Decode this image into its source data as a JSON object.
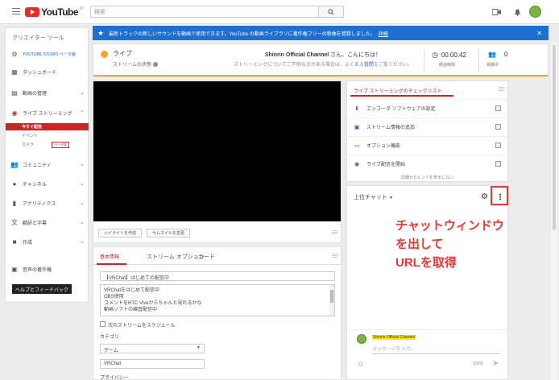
{
  "header": {
    "logo_text": "YouTube",
    "logo_sup": "JP",
    "search_placeholder": "検索"
  },
  "sidebar": {
    "title": "クリエイター ツール",
    "items": [
      {
        "label": "YOUTUBE STUDIO ベータ版",
        "icon": "gear-icon"
      },
      {
        "label": "ダッシュボード",
        "icon": "dashboard-icon"
      },
      {
        "label": "動画の管理",
        "icon": "video-manager-icon"
      },
      {
        "label": "ライブ ストリーミング",
        "icon": "live-streaming-icon"
      },
      {
        "label": "コミュニティ",
        "icon": "community-icon"
      },
      {
        "label": "チャンネル",
        "icon": "channel-icon"
      },
      {
        "label": "アナリティクス",
        "icon": "analytics-icon"
      },
      {
        "label": "翻訳と字幕",
        "icon": "translate-icon"
      },
      {
        "label": "作成",
        "icon": "create-icon"
      },
      {
        "label": "音声の著作権",
        "icon": "audio-icon"
      }
    ],
    "sub_items": [
      {
        "label": "今すぐ配信"
      },
      {
        "label": "イベント"
      },
      {
        "label": "カメラ",
        "badge": "ベータ版"
      }
    ],
    "help_button": "ヘルプとフィードバック"
  },
  "banner": {
    "text": "最新トラックの新しいサウンドを動画で使用できます。YouTube の動画ライブラリに著作権フリーの新曲を登録しました。",
    "link": "詳細",
    "color": "#1e6fd0"
  },
  "status": {
    "live_label": "ライブ",
    "state_label": "ストリームの状態",
    "greeting_name": "Shinrin Official Channel",
    "greeting_suffix": "さん、こんにちは！",
    "help_text": "ストリーミングについてご不明な点がある場合は、よくある",
    "help_link": "質問",
    "help_end": "をご覧ください。",
    "time": "00:00:42",
    "time_label": "経過時間",
    "viewers": "0",
    "viewers_label": "視聴中",
    "state_color": "#f5a623"
  },
  "video": {
    "highlight_button": "ハイライトを作成",
    "thumbnail_button": "サムネイルを変更"
  },
  "info": {
    "tabs": [
      "基本情報",
      "ストリーム オプション",
      "カード"
    ],
    "title_value": "【VRChat】はじめての配信中",
    "description_lines": [
      "VRChatをはじめて配信中",
      "OBS使用",
      "コメントをHTC Viveからちゃんと見れるかな",
      "動画ソフトの練習配信中"
    ],
    "schedule_label": "次のストリームをスケジュール",
    "category_label": "カテゴリ",
    "category_value": "ゲーム",
    "game_value": "VRChat",
    "privacy_label": "プライバシー"
  },
  "checklist": {
    "title": "ライブ ストリーミングのチェックリスト",
    "items": [
      {
        "label": "エンコーダ ソフトウェアの設定",
        "icon": "download-icon"
      },
      {
        "label": "ストリーム情報の追加",
        "icon": "info-add-icon"
      },
      {
        "label": "オプション機能",
        "icon": "card-icon"
      },
      {
        "label": "ライブ配信を開始",
        "icon": "broadcast-icon"
      }
    ],
    "footer": "詳細からヒントを表示しない"
  },
  "chat": {
    "header": "上位チャット",
    "annotation": [
      "チャットウィンドウ",
      "を出して",
      "URLを取得"
    ],
    "username": "Shinrin Official Channel",
    "input_placeholder": "メッセージを入力...",
    "counter": "0/200",
    "annotation_color": "#e53935"
  }
}
